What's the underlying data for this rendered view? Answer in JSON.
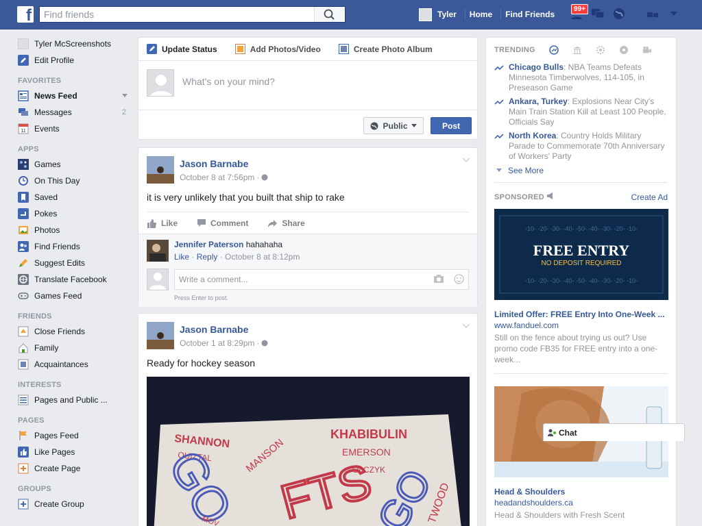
{
  "topbar": {
    "search_placeholder": "Find friends",
    "user_name": "Tyler",
    "home": "Home",
    "find_friends": "Find Friends",
    "notif_count": "99+"
  },
  "sidebar": {
    "profile_name": "Tyler McScreenshots",
    "edit_profile": "Edit Profile",
    "sections": {
      "favorites": "FAVORITES",
      "apps": "APPS",
      "friends": "FRIENDS",
      "interests": "INTERESTS",
      "pages": "PAGES",
      "groups": "GROUPS"
    },
    "favorites": [
      {
        "label": "News Feed"
      },
      {
        "label": "Messages",
        "count": "2"
      },
      {
        "label": "Events"
      }
    ],
    "apps": [
      {
        "label": "Games"
      },
      {
        "label": "On This Day"
      },
      {
        "label": "Saved"
      },
      {
        "label": "Pokes"
      },
      {
        "label": "Photos"
      },
      {
        "label": "Find Friends"
      },
      {
        "label": "Suggest Edits"
      },
      {
        "label": "Translate Facebook"
      },
      {
        "label": "Games Feed"
      }
    ],
    "friends": [
      {
        "label": "Close Friends"
      },
      {
        "label": "Family"
      },
      {
        "label": "Acquaintances"
      }
    ],
    "interests": [
      {
        "label": "Pages and Public ..."
      }
    ],
    "pages": [
      {
        "label": "Pages Feed"
      },
      {
        "label": "Like Pages"
      },
      {
        "label": "Create Page"
      }
    ],
    "groups": [
      {
        "label": "Create Group"
      }
    ]
  },
  "composer": {
    "tab_status": "Update Status",
    "tab_photos": "Add Photos/Video",
    "tab_album": "Create Photo Album",
    "placeholder": "What's on your mind?",
    "privacy": "Public",
    "post": "Post"
  },
  "posts": [
    {
      "author": "Jason Barnabe",
      "time": "October 8 at 7:56pm",
      "text": "it is very unlikely that you built that ship to rake",
      "actions": {
        "like": "Like",
        "comment": "Comment",
        "share": "Share"
      },
      "comment": {
        "author": "Jennifer Paterson",
        "text": "hahahaha",
        "like": "Like",
        "reply": "Reply",
        "time": "October 8 at 8:12pm"
      },
      "write_placeholder": "Write a comment...",
      "enter_hint": "Press Enter to post."
    },
    {
      "author": "Jason Barnabe",
      "time": "October 1 at 8:29pm",
      "text": "Ready for hockey season",
      "sign_words": [
        "SHANNON",
        "OUIZTAL",
        "KHABIBULIN",
        "EMERSON",
        "MANSON",
        "OLCZYK",
        "GO",
        "FTS",
        "GO",
        "TWOOD",
        "MOV"
      ]
    }
  ],
  "trending": {
    "title": "TRENDING",
    "items": [
      {
        "topic": "Chicago Bulls",
        "text": ": NBA Teams Defeats Minnesota Timberwolves, 114-105, in Preseason Game"
      },
      {
        "topic": "Ankara, Turkey",
        "text": ": Explosions Near City's Main Train Station Kill at Least 100 People, Officials Say"
      },
      {
        "topic": "North Korea",
        "text": ": Country Holds Military Parade to Commemorate 70th Anniversary of Workers' Party"
      }
    ],
    "see_more": "See More"
  },
  "sponsored": {
    "label": "SPONSORED",
    "create_ad": "Create Ad",
    "ads": [
      {
        "banner_title": "FREE ENTRY",
        "banner_sub": "NO DEPOSIT REQUIRED",
        "yard_numbers": "-10- -20- -30- -40- -50- -40- -30- -20- -10-",
        "title": "Limited Offer: FREE Entry Into One-Week ...",
        "url": "www.fanduel.com",
        "body": "Still on the fence about trying us out? Use promo code FB35 for FREE entry into a one-week..."
      },
      {
        "title": "Head & Shoulders",
        "url": "headandshoulders.ca",
        "body": "Head & Shoulders with Fresh Scent"
      }
    ]
  },
  "chat": {
    "label": "Chat"
  },
  "colors": {
    "brand": "#3b5998",
    "link": "#365899",
    "post_button": "#4267b2",
    "notification": "#fa3e3e"
  }
}
